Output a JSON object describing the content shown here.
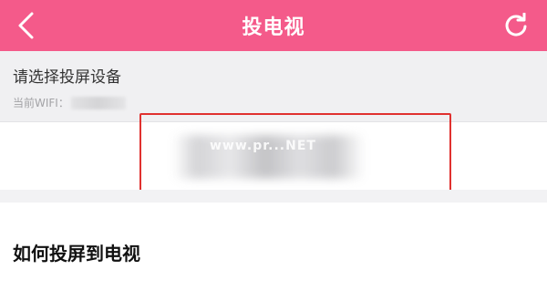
{
  "header": {
    "title": "投电视",
    "back_icon": "chevron-left-icon",
    "refresh_icon": "refresh-icon",
    "background": "#f45a8a"
  },
  "device_section": {
    "title": "请选择投屏设备",
    "wifi_label": "当前WIFI："
  },
  "device_list": {
    "watermark": "www.pr...NET"
  },
  "howto": {
    "title": "如何投屏到电视"
  }
}
